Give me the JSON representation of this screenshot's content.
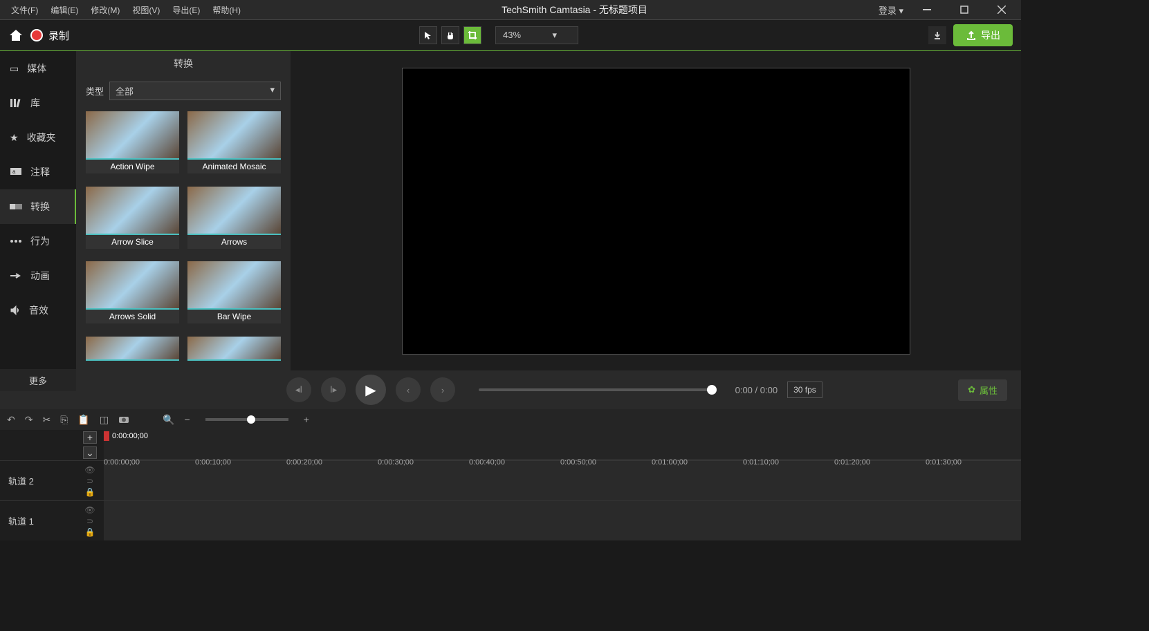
{
  "menu": {
    "file": "文件(F)",
    "edit": "编辑(E)",
    "modify": "修改(M)",
    "view": "视图(V)",
    "export": "导出(E)",
    "help": "帮助(H)"
  },
  "title": "TechSmith Camtasia - 无标题项目",
  "login": "登录 ▾",
  "record": "录制",
  "zoom": "43%",
  "export_btn": "导出",
  "sidebar": {
    "media": "媒体",
    "library": "库",
    "favorites": "收藏夹",
    "annotations": "注释",
    "transitions": "转换",
    "behaviors": "行为",
    "animations": "动画",
    "audio": "音效",
    "more": "更多"
  },
  "panel": {
    "title": "转换",
    "type_label": "类型",
    "type_value": "全部",
    "items": [
      "Action Wipe",
      "Animated Mosaic",
      "Arrow Slice",
      "Arrows",
      "Arrows Solid",
      "Bar Wipe"
    ]
  },
  "playback": {
    "time": "0:00 / 0:00",
    "fps": "30 fps",
    "properties": "属性"
  },
  "timeline": {
    "playhead": "0:00:00;00",
    "marks": [
      "0:00:00;00",
      "0:00:10;00",
      "0:00:20;00",
      "0:00:30;00",
      "0:00:40;00",
      "0:00:50;00",
      "0:01:00;00",
      "0:01:10;00",
      "0:01:20;00",
      "0:01:30;00"
    ],
    "track1": "轨道 1",
    "track2": "轨道 2"
  }
}
